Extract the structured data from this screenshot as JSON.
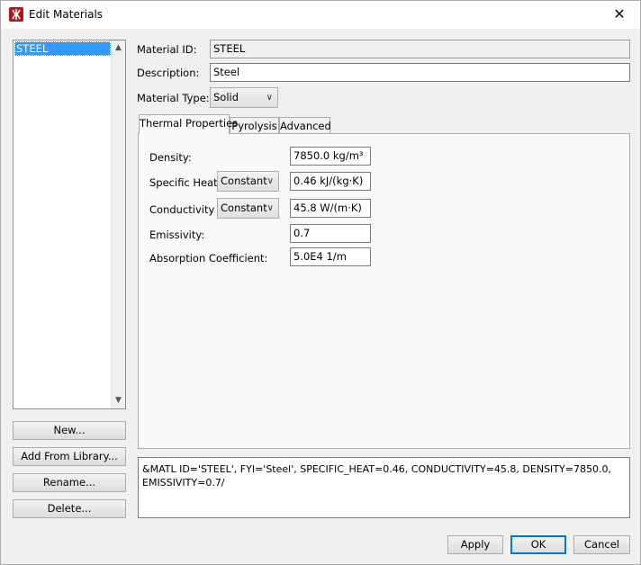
{
  "window": {
    "title": "Edit Materials",
    "app_icon": "fire-logo-icon",
    "close_icon": "close-icon"
  },
  "materials": {
    "items": [
      "STEEL"
    ]
  },
  "left_buttons": {
    "new": "New...",
    "add_from_library": "Add From Library...",
    "rename": "Rename...",
    "delete": "Delete..."
  },
  "form": {
    "material_id_label": "Material ID:",
    "material_id_value": "STEEL",
    "description_label": "Description:",
    "description_value": "Steel",
    "material_type_label": "Material Type:",
    "material_type_value": "Solid"
  },
  "tabs": [
    "Thermal Properties",
    "Pyrolysis",
    "Advanced"
  ],
  "thermal": {
    "density_label": "Density:",
    "density_value": "7850.0 kg/m³",
    "specific_heat_label": "Specific Heat",
    "specific_heat_mode": "Constant",
    "specific_heat_value": "0.46 kJ/(kg·K)",
    "conductivity_label": "Conductivity",
    "conductivity_mode": "Constant",
    "conductivity_value": "45.8 W/(m·K)",
    "emissivity_label": "Emissivity:",
    "emissivity_value": "0.7",
    "absorption_label": "Absorption Coefficient:",
    "absorption_value": "5.0E4 1/m"
  },
  "fds_text": "&MATL ID='STEEL', FYI='Steel', SPECIFIC_HEAT=0.46, CONDUCTIVITY=45.8, DENSITY=7850.0, EMISSIVITY=0.7/",
  "footer": {
    "apply": "Apply",
    "ok": "OK",
    "cancel": "Cancel"
  }
}
